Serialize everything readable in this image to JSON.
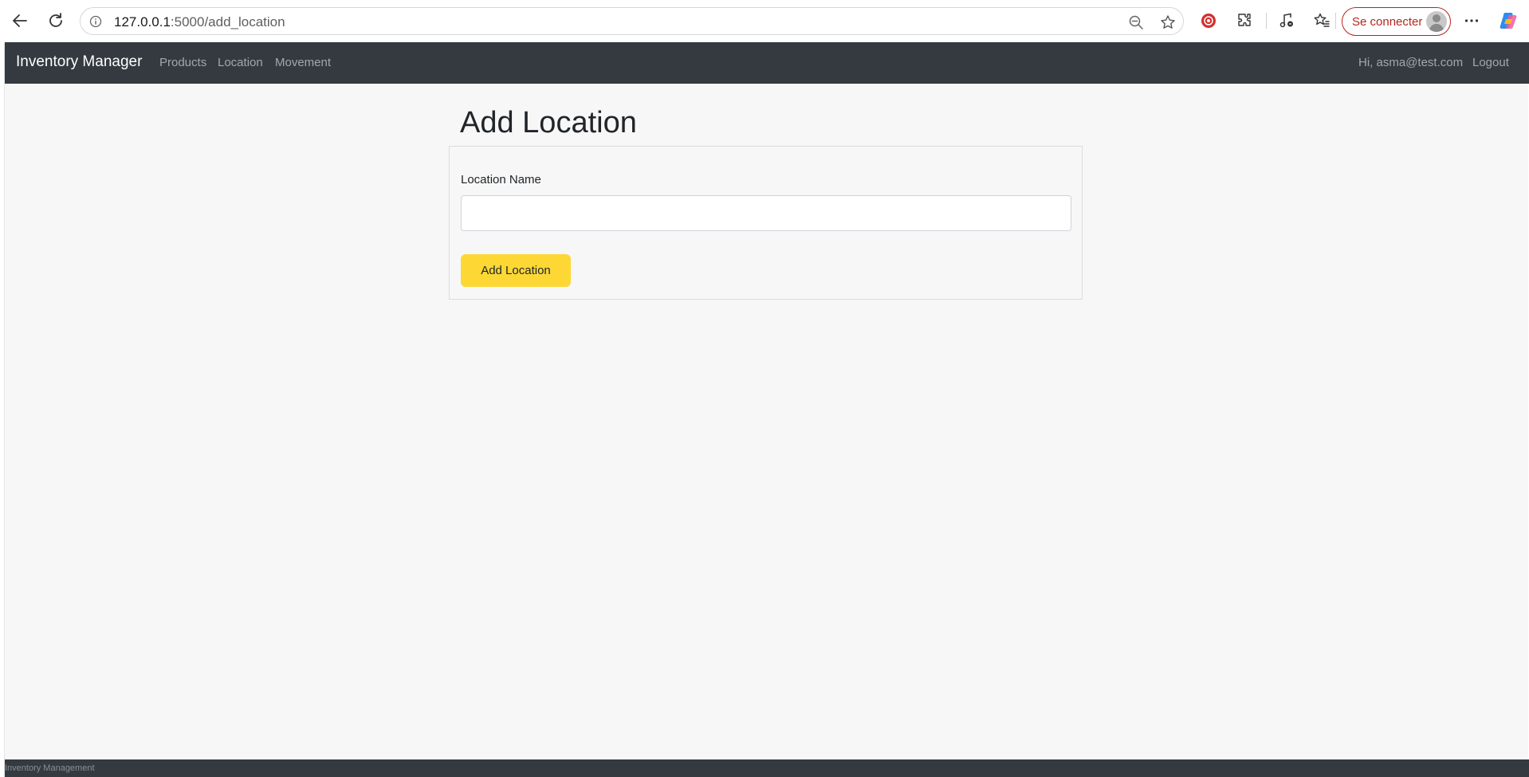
{
  "browser": {
    "url_host": "127.0.0.1",
    "url_path": ":5000/add_location",
    "signin_label": "Se connecter",
    "icons": [
      "back-icon",
      "reload-icon",
      "site-info-icon",
      "zoom-out-icon",
      "favorite-star-icon",
      "extension-red-icon",
      "extensions-puzzle-icon",
      "media-icon",
      "favorites-icon",
      "more-icon",
      "copilot-icon"
    ]
  },
  "app": {
    "brand": "Inventory Manager",
    "nav": {
      "products": "Products",
      "location": "Location",
      "movement": "Movement"
    },
    "user_greeting": "Hi, asma@test.com",
    "logout": "Logout"
  },
  "page": {
    "title": "Add Location",
    "form": {
      "label": "Location Name",
      "value": "",
      "placeholder": "",
      "submit_label": "Add Location"
    }
  },
  "footer": {
    "text": "Inventory Management"
  },
  "colors": {
    "navbar": "#343a40",
    "button": "#fdd835",
    "signin_accent": "#b3261e",
    "page_bg": "#f7f7f7"
  }
}
